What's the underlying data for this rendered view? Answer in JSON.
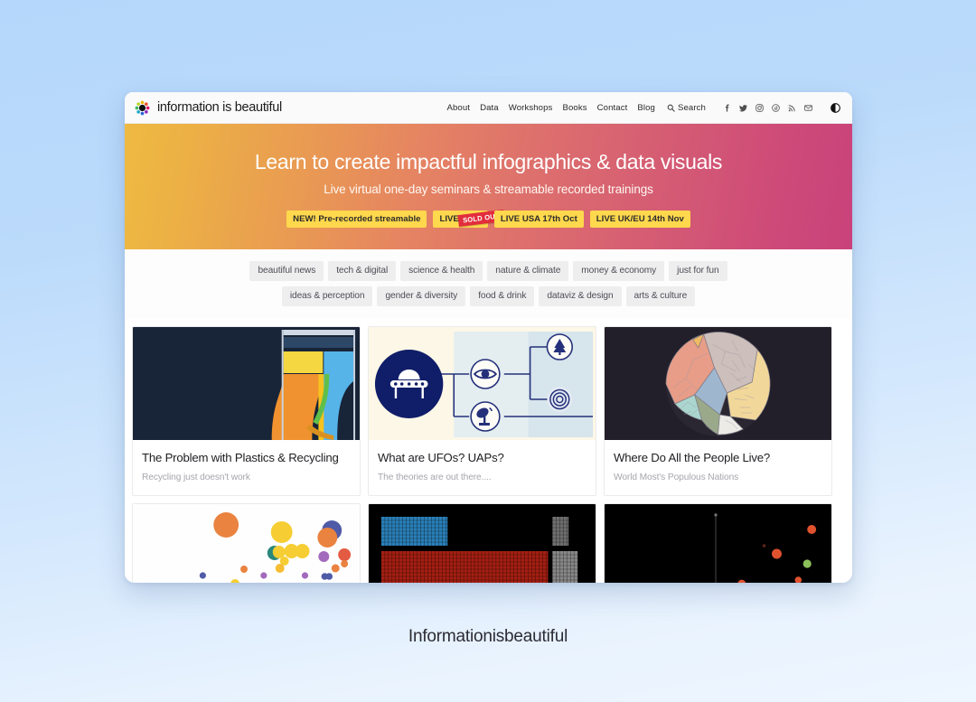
{
  "header": {
    "brand_name": "information is beautiful",
    "logo_icon": "sunburst-flower-logo",
    "nav_links": [
      "About",
      "Data",
      "Workshops",
      "Books",
      "Contact",
      "Blog"
    ],
    "search_label": "Search",
    "search_icon": "search-icon",
    "socials": [
      {
        "name": "facebook-icon"
      },
      {
        "name": "twitter-icon"
      },
      {
        "name": "instagram-icon"
      },
      {
        "name": "threads-icon"
      },
      {
        "name": "rss-icon"
      },
      {
        "name": "email-icon"
      }
    ],
    "darkmode_icon": "dark-mode-toggle-icon"
  },
  "hero": {
    "title": "Learn to create impactful infographics & data visuals",
    "subtitle": "Live virtual one-day seminars & streamable recorded trainings",
    "badges": [
      {
        "label": "NEW! Pre-recorded streamable",
        "stamp": ""
      },
      {
        "label": "LIVE              June",
        "stamp": "SOLD OUT"
      },
      {
        "label": "LIVE USA 17th Oct",
        "stamp": ""
      },
      {
        "label": "LIVE UK/EU 14th Nov",
        "stamp": ""
      }
    ],
    "gradient_start": "#eeba42",
    "gradient_end": "#c9427b"
  },
  "categories": {
    "row1": [
      "beautiful news",
      "tech & digital",
      "science & health",
      "nature & climate",
      "money & economy",
      "just for fun"
    ],
    "row2": [
      "ideas & perception",
      "gender & diversity",
      "food & drink",
      "dataviz & design",
      "arts & culture"
    ]
  },
  "cards": [
    {
      "title": "The Problem with Plastics & Recycling",
      "description": "Recycling just doesn't work",
      "thumb_name": "sankey-diagram-thumbnail"
    },
    {
      "title": "What are UFOs? UAPs?",
      "description": "The theories are out there....",
      "thumb_name": "ufo-taxonomy-diagram-thumbnail"
    },
    {
      "title": "Where Do All the People Live?",
      "description": "World Most's Populous Nations",
      "thumb_name": "voronoi-treemap-thumbnail"
    },
    {
      "title": "",
      "description": "",
      "thumb_name": "bubble-scatter-chart-thumbnail"
    },
    {
      "title": "",
      "description": "",
      "thumb_name": "grid-matrix-chart-thumbnail"
    },
    {
      "title": "",
      "description": "",
      "thumb_name": "dark-scatter-plot-thumbnail"
    }
  ],
  "caption": "Informationisbeautiful"
}
